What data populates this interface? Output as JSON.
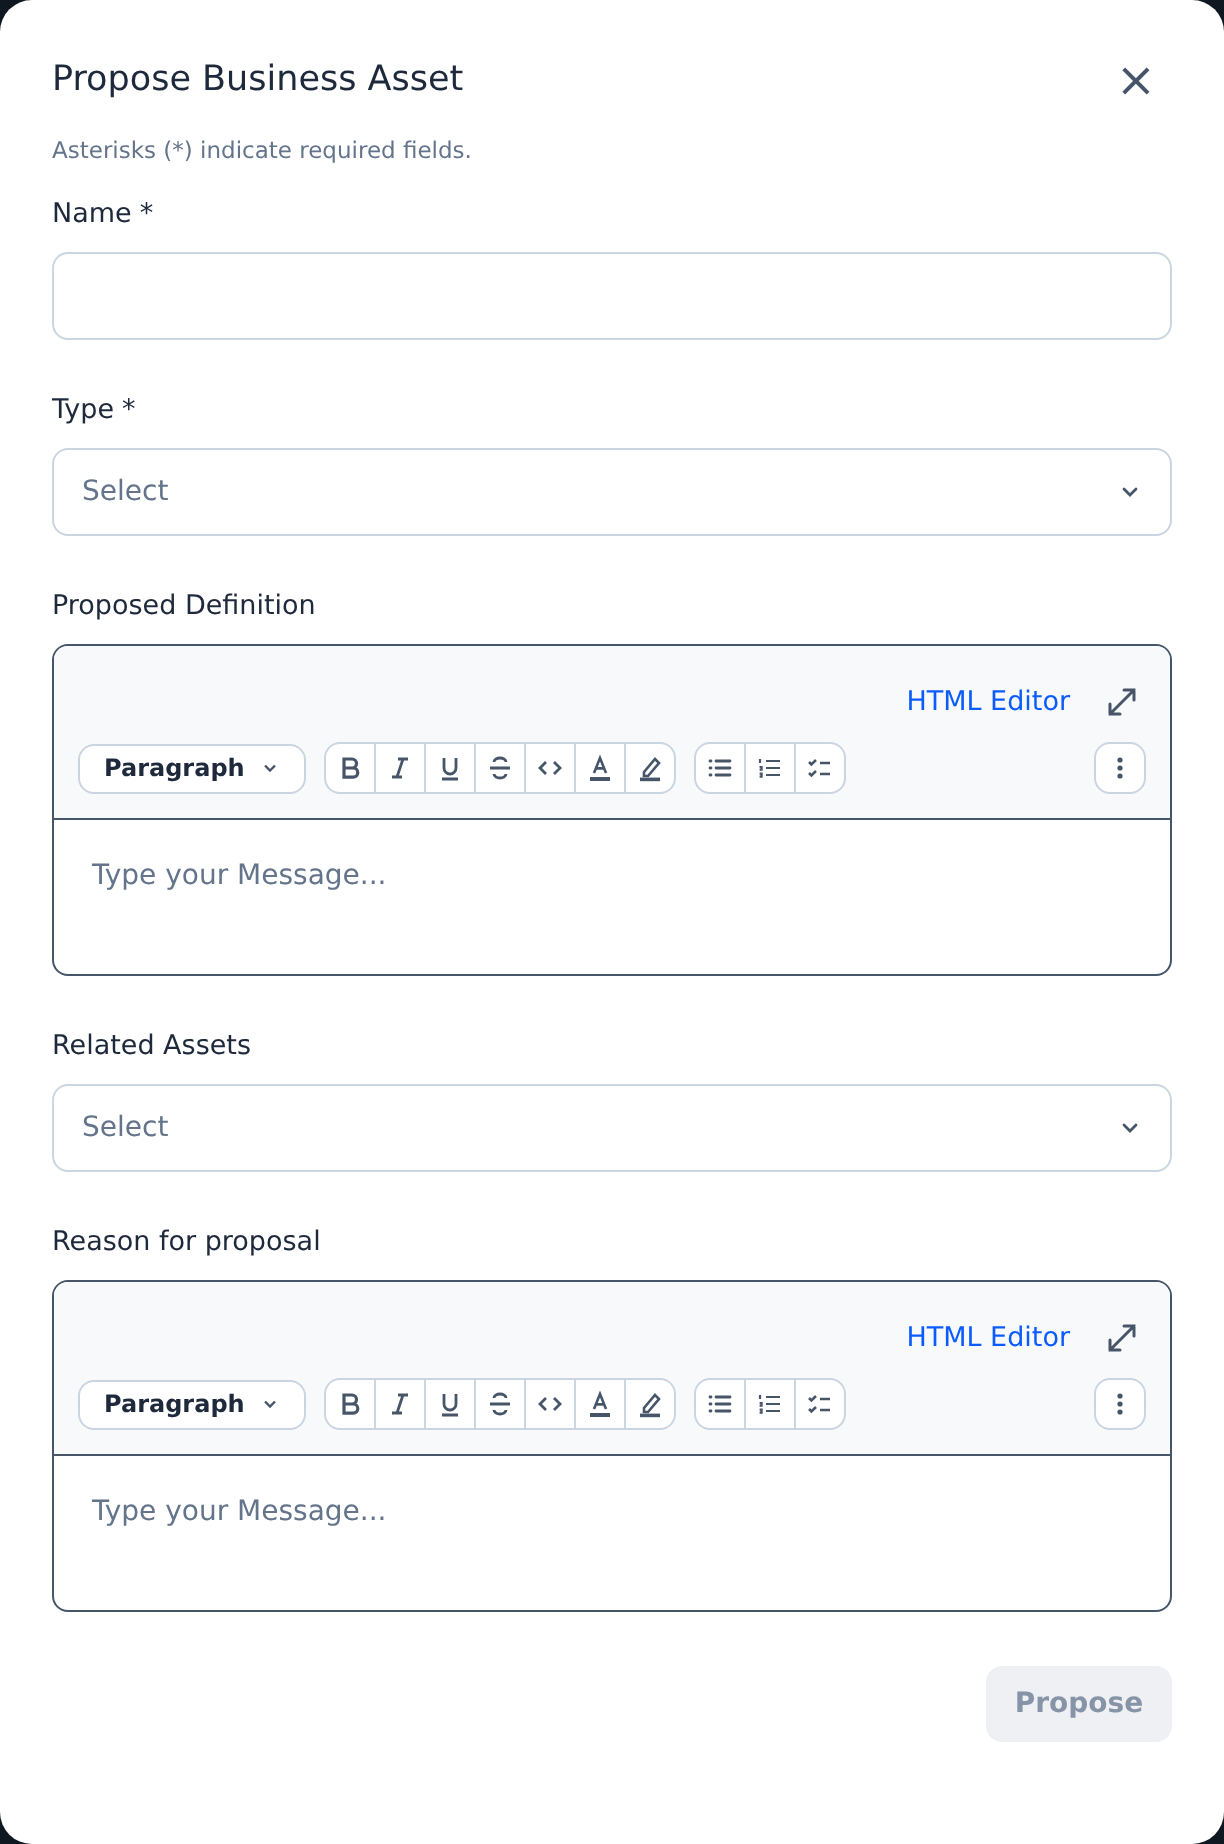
{
  "dialog": {
    "title": "Propose Business Asset",
    "close_icon": "×",
    "note": "Asterisks (*) indicate required fields."
  },
  "fields": [
    {
      "kind": "text",
      "label": "Name",
      "required_mark": "*"
    },
    {
      "kind": "select",
      "label": "Type",
      "required_mark": "*",
      "placeholder": "Select"
    },
    {
      "kind": "editor",
      "label": "Proposed Definition",
      "html_link": "HTML Editor",
      "style": "Paragraph",
      "placeholder": "Type your Message..."
    },
    {
      "kind": "select",
      "label": "Related Assets",
      "placeholder": "Select"
    },
    {
      "kind": "editor",
      "label": "Reason for proposal",
      "html_link": "HTML Editor",
      "style": "Paragraph",
      "placeholder": "Type your Message..."
    }
  ],
  "submit": {
    "label": "Propose",
    "disabled": true
  }
}
